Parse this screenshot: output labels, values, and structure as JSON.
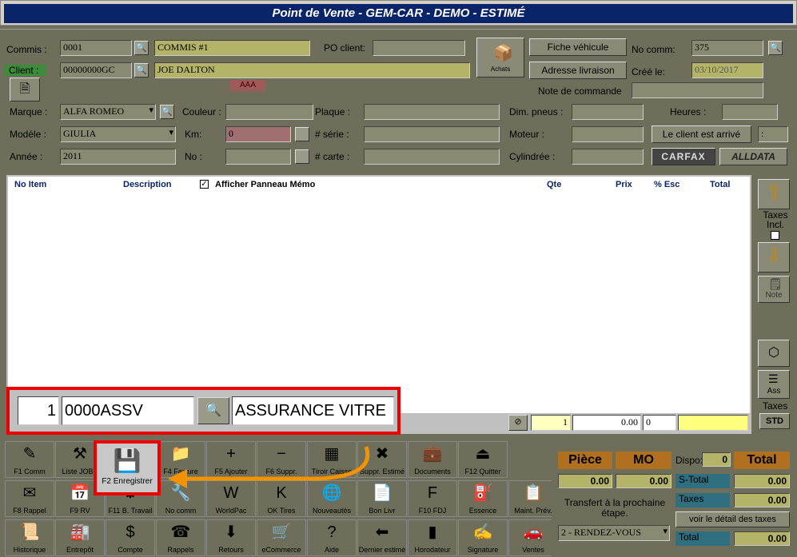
{
  "title": "Point de Vente - GEM-CAR - DEMO - ESTIMÉ",
  "header": {
    "commis_label": "Commis :",
    "commis_code": "0001",
    "commis_name": "COMMIS #1",
    "client_label": "Client :",
    "client_code": "00000000GC",
    "client_name": "JOE DALTON",
    "client_badge": "AAA",
    "po_label": "PO client:",
    "po_value": "",
    "achats_label": "Achats",
    "fiche_btn": "Fiche véhicule",
    "adresse_btn": "Adresse livraison",
    "nocomm_label": "No comm:",
    "nocomm_value": "375",
    "cree_label": "Créé le:",
    "cree_value": "03/10/2017",
    "note_label": "Note de commande",
    "marque_label": "Marque :",
    "marque_value": "ALFA ROMEO",
    "modele_label": "Modèle :",
    "modele_value": "GIULIA",
    "annee_label": "Année :",
    "annee_value": "2011",
    "couleur_label": "Couleur :",
    "km_label": "Km:",
    "km_value": "0",
    "no_label": "No :",
    "plaque_label": "Plaque :",
    "serie_label": "# série :",
    "carte_label": "# carte :",
    "dim_label": "Dim. pneus :",
    "moteur_label": "Moteur :",
    "cylindree_label": "Cylindrée :",
    "heures_label": "Heures :",
    "arrive_btn": "Le client est arrivé",
    "colon": ":",
    "carfax": "CARFAX",
    "alldata": "ALLDATA"
  },
  "grid": {
    "headers": [
      "No Item",
      "Description",
      "Qte",
      "Prix",
      "% Esc",
      "Total"
    ],
    "memo_label": "Afficher Panneau Mémo",
    "entry": {
      "qty": "1",
      "code": "0000ASSV",
      "desc": "ASSURANCE VITRE",
      "qte": "1",
      "prix": "0.00",
      "esc": "0"
    }
  },
  "right": {
    "taxes_incl": "Taxes Incl.",
    "note": "Note",
    "ass": "Ass",
    "taxes": "Taxes",
    "std": "STD"
  },
  "toolbar": [
    [
      {
        "icon": "✎",
        "label": "F1 Comm"
      },
      {
        "icon": "⚒",
        "label": "Liste JOBS"
      },
      {
        "icon": "💾",
        "label": "F2 Enregistrer"
      },
      {
        "icon": "📁",
        "label": "F4 Facture"
      },
      {
        "icon": "+",
        "label": "F5 Ajouter"
      },
      {
        "icon": "−",
        "label": "F6 Suppr."
      },
      {
        "icon": "▦",
        "label": "Tiroir Caisse"
      },
      {
        "icon": "✖",
        "label": "Suppr. Estimé"
      },
      {
        "icon": "💼",
        "label": "Documents"
      },
      {
        "icon": "⏏",
        "label": "F12 Quitter"
      }
    ],
    [
      {
        "icon": "✉",
        "label": "F8 Rappel"
      },
      {
        "icon": "📅",
        "label": "F9 RV"
      },
      {
        "icon": "⚙",
        "label": "F11 B. Travail"
      },
      {
        "icon": "🔧",
        "label": "No comm"
      },
      {
        "icon": "W",
        "label": "WorldPac"
      },
      {
        "icon": "K",
        "label": "OK Tires"
      },
      {
        "icon": "🌐",
        "label": "Nouveautés"
      },
      {
        "icon": "📄",
        "label": "Bon Livr"
      },
      {
        "icon": "F",
        "label": "F10 FDJ"
      },
      {
        "icon": "⛽",
        "label": "Essence"
      },
      {
        "icon": "📋",
        "label": "Maint. Prév."
      }
    ],
    [
      {
        "icon": "📜",
        "label": "Historique"
      },
      {
        "icon": "🏭",
        "label": "Entrepôt"
      },
      {
        "icon": "$",
        "label": "Compte"
      },
      {
        "icon": "☎",
        "label": "Rappels"
      },
      {
        "icon": "⬇",
        "label": "Retours"
      },
      {
        "icon": "🛒",
        "label": "eCommerce"
      },
      {
        "icon": "?",
        "label": "Aide"
      },
      {
        "icon": "⬅",
        "label": "Dernier estimé"
      },
      {
        "icon": "▮",
        "label": "Horodateur"
      },
      {
        "icon": "✍",
        "label": "Signature"
      },
      {
        "icon": "🚗",
        "label": "Ventes"
      }
    ]
  ],
  "totals": {
    "piece": "Pièce",
    "mo": "MO",
    "dispo_label": "Dispo:",
    "dispo_value": "0",
    "total": "Total",
    "piece_value": "0.00",
    "mo_value": "0.00",
    "stotal_label": "S-Total",
    "stotal_value": "0.00",
    "taxes_label": "Taxes",
    "taxes_value": "0.00",
    "transfert": "Transfert à la prochaine étape.",
    "detail_btn": "voir le détail des taxes",
    "etape": "2 - RENDEZ-VOUS",
    "total_label": "Total",
    "total_value": "0.00"
  },
  "colors": {
    "title_bg": "#0a246a",
    "highlight": "#e00000",
    "arrow": "#f39200",
    "grid_header": "#0a246a"
  }
}
